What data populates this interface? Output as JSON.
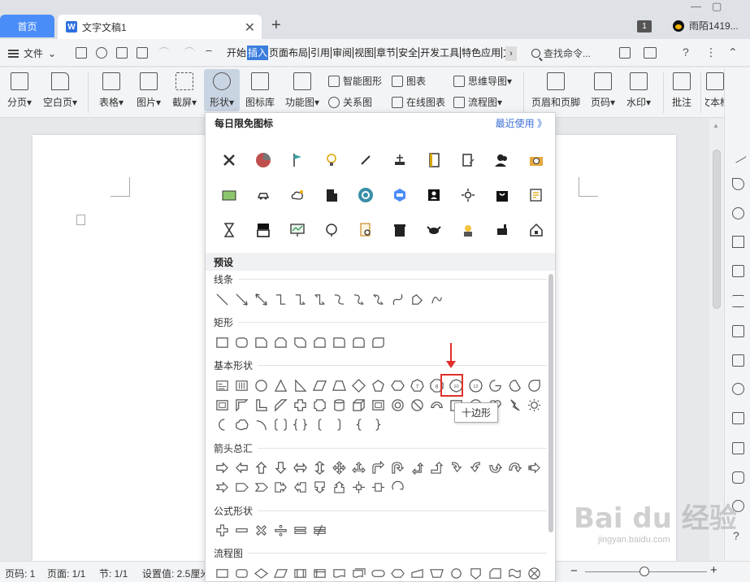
{
  "titlebar": {
    "home_tab": "首页",
    "doc_tab": "文字文稿1",
    "doc_icon": "W",
    "close": "✕",
    "add": "+",
    "badge": "1",
    "user": "雨陌1419...",
    "win_min": "—",
    "win_max": "▢"
  },
  "menubar": {
    "file": "文件",
    "file_arrow": "⌄",
    "tabs": [
      "开始",
      "插入",
      "页面布局",
      "引用",
      "审阅",
      "视图",
      "章节",
      "安全",
      "开发工具",
      "特色应用",
      "文"
    ],
    "active_tab": "插入",
    "more": "›",
    "search": "查找命令...",
    "help": "?",
    "more_dots": "⋮",
    "collapse": "⌃"
  },
  "ribbon": {
    "big_buttons": [
      "分页",
      "空白页",
      "表格",
      "图片",
      "截屏",
      "形状",
      "图标库",
      "功能图",
      "页眉和页脚",
      "页码",
      "水印",
      "批注",
      "文本框"
    ],
    "small_buttons": [
      "智能图形",
      "图表",
      "思维导图",
      "关系图",
      "在线图表",
      "流程图"
    ],
    "dropdown_mark": "▾"
  },
  "sidebar": {
    "scroll_up": "▲",
    "plus": "+",
    "minus": "−"
  },
  "panel": {
    "title": "每日限免图标",
    "recent": "最近使用 》",
    "preset": "预设",
    "categories": [
      "线条",
      "矩形",
      "基本形状",
      "箭头总汇",
      "公式形状",
      "流程图"
    ],
    "tooltip": "十边形",
    "decagon_label": "10",
    "dodecagon_label": "12",
    "heptagon_label": "7",
    "octagon_label": "8"
  },
  "statusbar": {
    "page": "页码: 1",
    "pages": "页面: 1/1",
    "section": "节: 1/1",
    "setting": "设置值: 2.5厘米",
    "zoom_minus": "−",
    "zoom_plus": "+",
    "zoom_level": 0.5
  },
  "watermark": {
    "brand": "Bai du 经验",
    "url": "jingyan.baidu.com"
  },
  "colors": {
    "accent": "#4a8df8",
    "active_tab": "#3b7ddd",
    "highlight": "#e0312a",
    "link": "#3b6fd6"
  }
}
